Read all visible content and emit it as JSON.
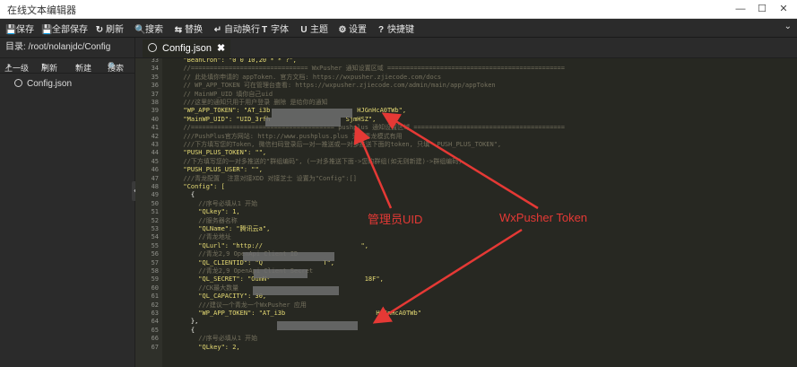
{
  "window": {
    "title": "在线文本编辑器",
    "minimize": "—",
    "maximize": "☐",
    "close": "✕"
  },
  "toolbar": {
    "items": [
      {
        "icon": "💾",
        "label": "保存"
      },
      {
        "icon": "💾",
        "label": "全部保存"
      },
      {
        "icon": "↻",
        "label": "刷新"
      },
      {
        "icon": "🔍",
        "label": "搜索"
      },
      {
        "icon": "⇆",
        "label": "替换"
      },
      {
        "icon": "↵",
        "label": "自动换行"
      },
      {
        "icon": "T",
        "label": "字体"
      },
      {
        "icon": "U",
        "label": "主题"
      },
      {
        "icon": "⚙",
        "label": "设置"
      },
      {
        "icon": "?",
        "label": "快捷键"
      }
    ],
    "collapse": "⌄"
  },
  "sidebar": {
    "dir_label": "目录: /root/nolanjdc/Config",
    "tools": [
      {
        "icon": "↗",
        "label": "上一级"
      },
      {
        "icon": "↻",
        "label": "刷新"
      },
      {
        "icon": "+",
        "label": "新建"
      },
      {
        "icon": "🔍",
        "label": "搜索"
      }
    ],
    "file": "Config.json",
    "collapse_handle": "«"
  },
  "tab": {
    "name": "Config.json",
    "close": "✖"
  },
  "editor": {
    "lines": [
      {
        "n": "33",
        "t": "  \"BeanCron\": \"0 0 10,20 * * ?\","
      },
      {
        "n": "34",
        "t": "  //=============================== WxPusher 通知设置区域 ==============================================="
      },
      {
        "n": "35",
        "t": "  // 此处填你申请的 appToken. 官方文档: https://wxpusher.zjiecode.com/docs"
      },
      {
        "n": "36",
        "t": "  // WP_APP_TOKEN 可在管理台查看: https://wxpusher.zjiecode.com/admin/main/app/appToken"
      },
      {
        "n": "37",
        "t": "  // MainWP_UID 填你自己uid"
      },
      {
        "n": "38",
        "t": "  ///这里的通知只用于用户登录 删除 是给你的通知"
      },
      {
        "n": "39",
        "t": "  \"WP_APP_TOKEN\": \"AT_i3b                       HJGnHcA0TWb\","
      },
      {
        "n": "40",
        "t": "  \"MainWP_UID\": \"UID_3rfh                    SjmHSZ\","
      },
      {
        "n": "41",
        "t": "  //====================================== pushplus 通知设置区域 ========================================"
      },
      {
        "n": "42",
        "t": "  ///PushPlus官方网站: http://www.pushplus.plus 只有青龙模式有用"
      },
      {
        "n": "43",
        "t": "  ///下方填写您的Token, 微信扫码登录后一对一推送或一对多推送下面的token, 只填\" PUSH_PLUS_TOKEN\","
      },
      {
        "n": "44",
        "t": "  \"PUSH_PLUS_TOKEN\": \"\","
      },
      {
        "n": "45",
        "t": "  //下方填写您的一对多推送的\"群组编码\", (一对多推送下面->您的群组(如无则新建)->群组编码)"
      },
      {
        "n": "46",
        "t": "  \"PUSH_PLUS_USER\": \"\","
      },
      {
        "n": "47",
        "t": "  ///青龙配置  注意对接XDD 对接芝士 设置为\"Config\":[]"
      },
      {
        "n": "48",
        "t": "  \"Config\": ["
      },
      {
        "n": "49",
        "t": "    {"
      },
      {
        "n": "50",
        "t": "      //序号必填从1 开始"
      },
      {
        "n": "51",
        "t": "      \"QLkey\": 1,"
      },
      {
        "n": "52",
        "t": "      //服务器名称"
      },
      {
        "n": "53",
        "t": "      \"QLName\": \"腾讯云a\","
      },
      {
        "n": "54",
        "t": "      //青龙地址"
      },
      {
        "n": "55",
        "t": "      \"QLurl\": \"http://                          \","
      },
      {
        "n": "56",
        "t": "      //青龙2,9 OpenApi Client ID"
      },
      {
        "n": "57",
        "t": "      \"QL_CLIENTID\": \"Q                T\","
      },
      {
        "n": "58",
        "t": "      //青龙2,9 OpenApi Client Secret"
      },
      {
        "n": "59",
        "t": "      \"QL_SECRET\": \"OumN-                         18F\","
      },
      {
        "n": "60",
        "t": "      //CK最大数量"
      },
      {
        "n": "61",
        "t": "      \"QL_CAPACITY\": 30,"
      },
      {
        "n": "62",
        "t": "      ///建议一个青龙一个WxPusher 应用"
      },
      {
        "n": "63",
        "t": "      \"WP_APP_TOKEN\": \"AT_i3b                        HJGnHcA0TWb\""
      },
      {
        "n": "64",
        "t": "    },"
      },
      {
        "n": "65",
        "t": "    {"
      },
      {
        "n": "66",
        "t": "      //序号必填从1 开始"
      },
      {
        "n": "67",
        "t": "      \"QLkey\": 2,"
      }
    ]
  },
  "annotations": {
    "uid_label": "管理员UID",
    "token_label": "WxPusher Token",
    "color": "#e53935"
  }
}
